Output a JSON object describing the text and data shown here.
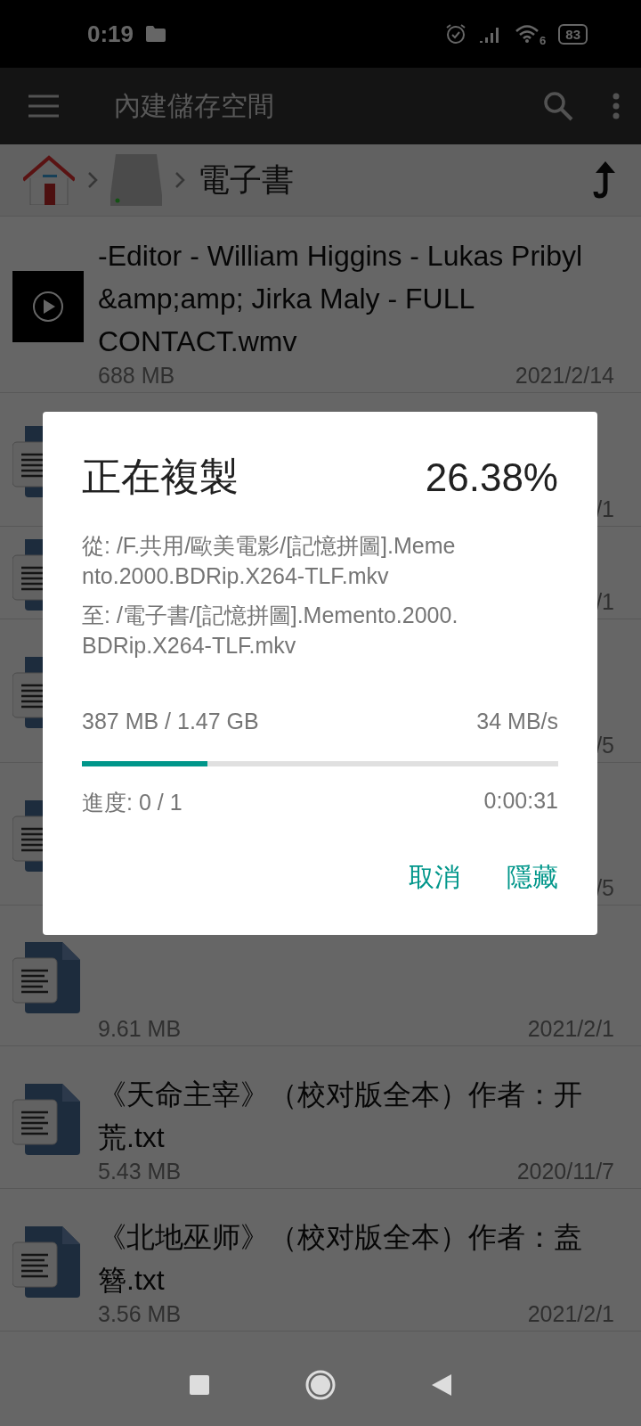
{
  "status_bar": {
    "time": "0:19",
    "wifi_label": "6",
    "battery": "83"
  },
  "toolbar": {
    "title": "內建儲存空間"
  },
  "breadcrumb": {
    "current": "電子書"
  },
  "files": [
    {
      "kind": "video",
      "name": "-Editor - William Higgins - Lukas Pribyl &amp;amp; Jirka Maly - FULL CONTACT.wmv",
      "size": "688 MB",
      "date": "2021/2/14"
    },
    {
      "kind": "covered",
      "date": "/1"
    },
    {
      "kind": "covered",
      "date": "/1"
    },
    {
      "kind": "covered",
      "date": "/5"
    },
    {
      "kind": "covered",
      "date": "/5"
    },
    {
      "kind": "covered",
      "size": "9.61 MB",
      "date": "2021/2/1"
    },
    {
      "kind": "text",
      "name": "《天命主宰》（校对版全本）作者：开荒.txt",
      "size": "5.43 MB",
      "date": "2020/11/7"
    },
    {
      "kind": "text",
      "name": "《北地巫师》（校对版全本）作者：盍簪.txt",
      "size": "3.56 MB",
      "date": "2021/2/1"
    }
  ],
  "dialog": {
    "title": "正在複製",
    "percent": "26.38%",
    "from": "從: /F.共用/歐美電影/[記憶拼圖].Memento.2000.BDRip.X264-TLF.mkv",
    "to": "至: /電子書/[記憶拼圖].Memento.2000.BDRip.X264-TLF.mkv",
    "transferred": "387 MB / 1.47 GB",
    "speed": "34 MB/s",
    "level": 0.2638,
    "count": "進度: 0 / 1",
    "remaining": "0:00:31",
    "buttons": [
      "取消",
      "隱藏"
    ]
  }
}
